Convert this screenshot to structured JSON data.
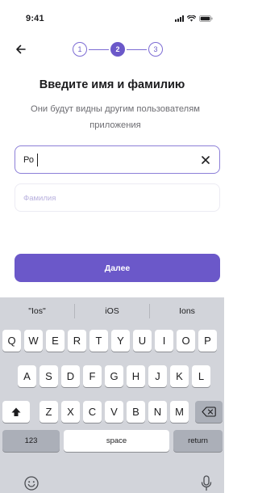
{
  "status_bar": {
    "time": "9:41"
  },
  "stepper": {
    "steps": [
      {
        "label": "1",
        "state": "inactive"
      },
      {
        "label": "2",
        "state": "active"
      },
      {
        "label": "3",
        "state": "inactive"
      }
    ]
  },
  "form": {
    "title": "Введите имя и фамилию",
    "subtitle": "Они будут видны другим пользователям приложения",
    "first_name": {
      "value": "Ро"
    },
    "last_name": {
      "placeholder": "Фамилия",
      "value": ""
    },
    "submit_label": "Далее"
  },
  "keyboard": {
    "suggestions": [
      "\"Ios\"",
      "iOS",
      "Ions"
    ],
    "row1": [
      "Q",
      "W",
      "E",
      "R",
      "T",
      "Y",
      "U",
      "I",
      "O",
      "P"
    ],
    "row2": [
      "A",
      "S",
      "D",
      "F",
      "G",
      "H",
      "J",
      "K",
      "L"
    ],
    "row3": [
      "Z",
      "X",
      "C",
      "V",
      "B",
      "N",
      "M"
    ],
    "numbers_label": "123",
    "space_label": "space",
    "return_label": "return"
  },
  "icons": {
    "back": "arrow-left-icon",
    "clear": "close-icon",
    "shift": "shift-icon",
    "delete": "backspace-icon",
    "emoji": "emoji-icon",
    "dictation": "microphone-icon"
  },
  "colors": {
    "accent": "#6b58c9",
    "input_focus_border": "#8c7fd8",
    "keyboard_bg": "#d2d4da",
    "key_dark": "#abafb8"
  }
}
